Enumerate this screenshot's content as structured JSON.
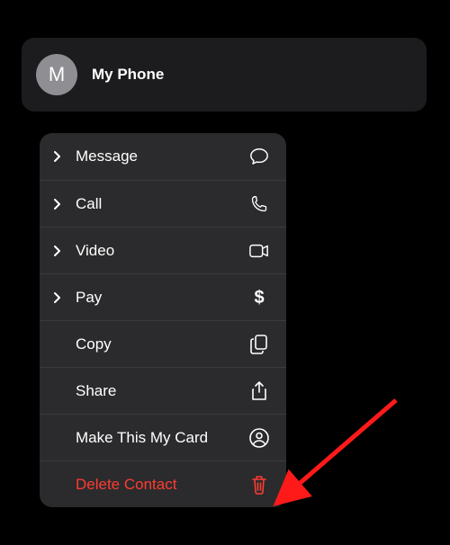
{
  "contact": {
    "initial": "M",
    "name": "My Phone"
  },
  "menu": {
    "message": "Message",
    "call": "Call",
    "video": "Video",
    "pay": "Pay",
    "copy": "Copy",
    "share": "Share",
    "mycard": "Make This My Card",
    "delete": "Delete Contact"
  },
  "colors": {
    "destructive": "#ff3b30",
    "surface": "#1c1c1e",
    "menu": "#2b2b2d"
  }
}
